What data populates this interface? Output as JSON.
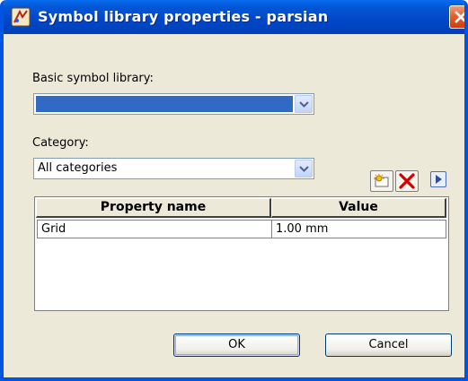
{
  "window": {
    "title": "Symbol library properties - parsian",
    "icon": "app-icon",
    "close_icon": "close-icon"
  },
  "basic_library": {
    "label": "Basic symbol library:",
    "value": ""
  },
  "category": {
    "label": "Category:",
    "value": "All categories"
  },
  "toolbar": {
    "add_icon": "add-property-icon",
    "delete_icon": "delete-property-icon",
    "expand_icon": "play-arrow-icon"
  },
  "grid": {
    "columns": [
      "Property name",
      "Value"
    ],
    "rows": [
      {
        "name": "Grid",
        "value": "1.00 mm"
      }
    ]
  },
  "buttons": {
    "ok": "OK",
    "cancel": "Cancel"
  },
  "colors": {
    "titlebar": "#0054e3",
    "selection": "#316ac5",
    "close": "#e25b2c",
    "delete": "#d40000"
  }
}
